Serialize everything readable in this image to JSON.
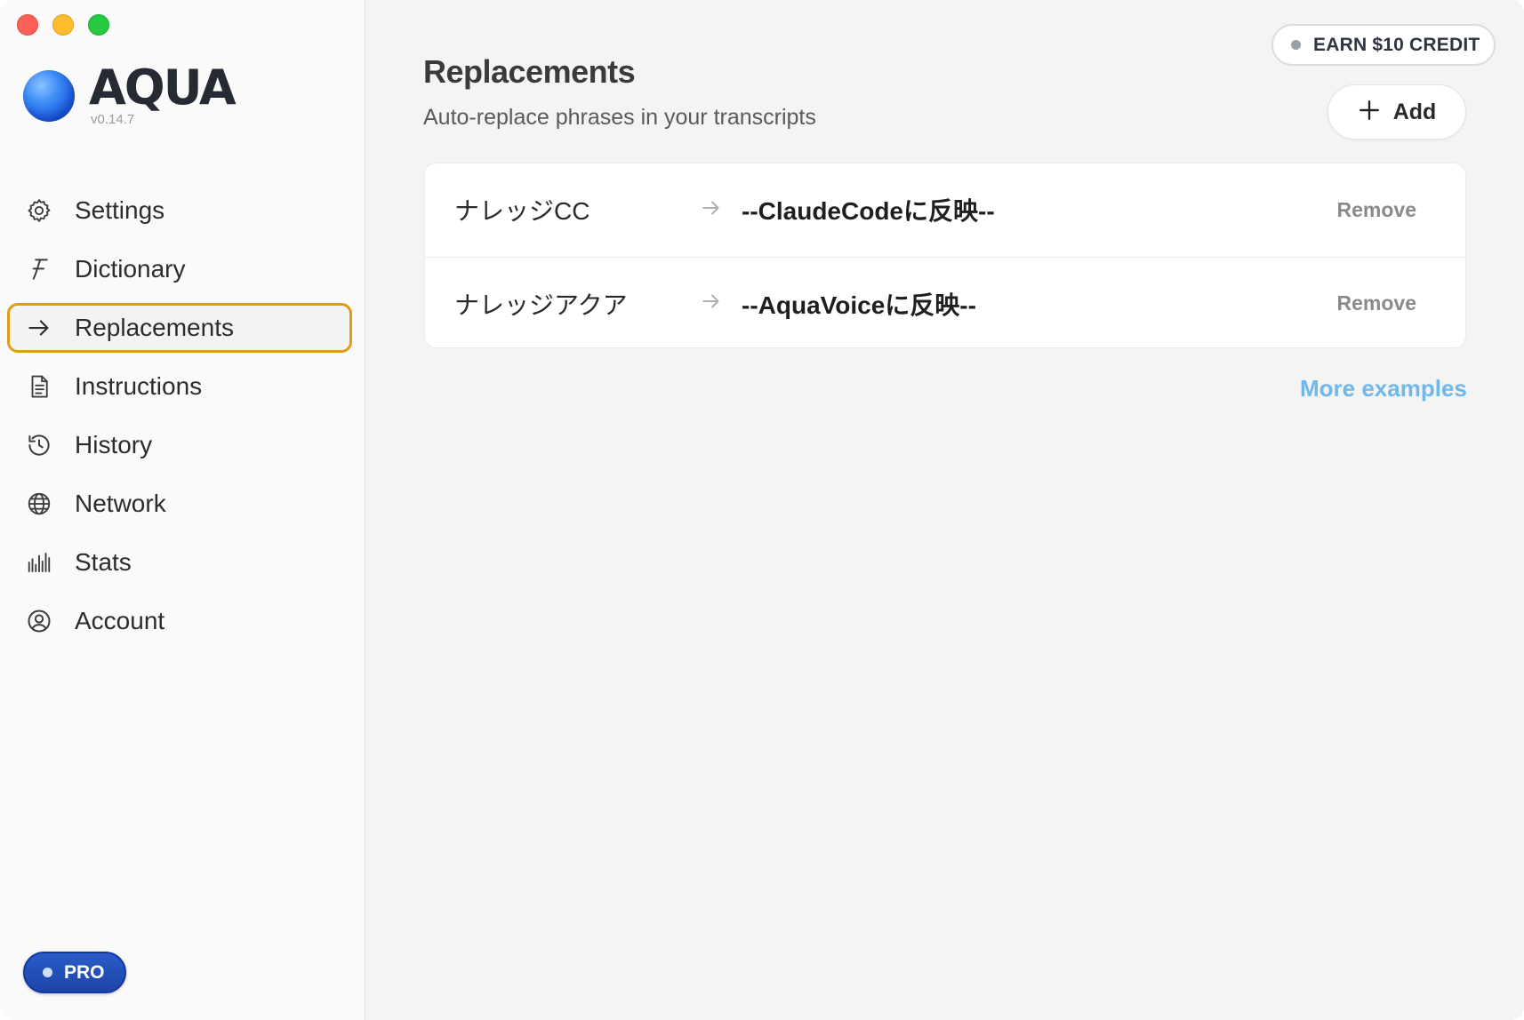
{
  "window": {
    "controls": [
      "close",
      "minimize",
      "zoom"
    ]
  },
  "brand": {
    "name": "AQUA",
    "version": "v0.14.7"
  },
  "sidebar": {
    "items": [
      {
        "label": "Settings",
        "icon": "gear-icon"
      },
      {
        "label": "Dictionary",
        "icon": "script-f-icon"
      },
      {
        "label": "Replacements",
        "icon": "arrow-right-icon",
        "active": true
      },
      {
        "label": "Instructions",
        "icon": "document-icon"
      },
      {
        "label": "History",
        "icon": "history-clock-icon"
      },
      {
        "label": "Network",
        "icon": "globe-icon"
      },
      {
        "label": "Stats",
        "icon": "bar-stats-icon"
      },
      {
        "label": "Account",
        "icon": "user-circle-icon"
      }
    ],
    "plan_badge": "PRO"
  },
  "header": {
    "earn_label": "EARN $10 CREDIT",
    "title": "Replacements",
    "subtitle": "Auto-replace phrases in your transcripts",
    "add_label": "Add"
  },
  "replacements": [
    {
      "from": "ナレッジCC",
      "to": "--ClaudeCodeに反映--",
      "remove_label": "Remove"
    },
    {
      "from": "ナレッジアクア",
      "to": "--AquaVoiceに反映--",
      "remove_label": "Remove"
    }
  ],
  "more_examples_label": "More examples",
  "colors": {
    "active_border": "#e39a17",
    "link": "#6eb8ee",
    "pro_badge": "#1c44a8"
  }
}
